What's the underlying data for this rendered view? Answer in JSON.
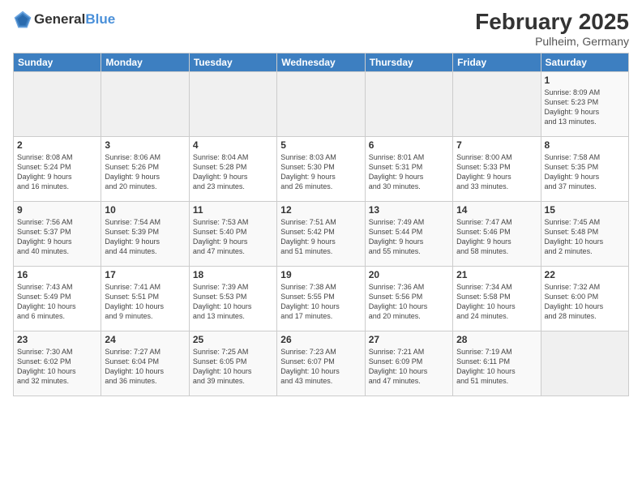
{
  "header": {
    "logo_general": "General",
    "logo_blue": "Blue",
    "title": "February 2025",
    "location": "Pulheim, Germany"
  },
  "days_of_week": [
    "Sunday",
    "Monday",
    "Tuesday",
    "Wednesday",
    "Thursday",
    "Friday",
    "Saturday"
  ],
  "weeks": [
    [
      {
        "day": "",
        "info": ""
      },
      {
        "day": "",
        "info": ""
      },
      {
        "day": "",
        "info": ""
      },
      {
        "day": "",
        "info": ""
      },
      {
        "day": "",
        "info": ""
      },
      {
        "day": "",
        "info": ""
      },
      {
        "day": "1",
        "info": "Sunrise: 8:09 AM\nSunset: 5:23 PM\nDaylight: 9 hours\nand 13 minutes."
      }
    ],
    [
      {
        "day": "2",
        "info": "Sunrise: 8:08 AM\nSunset: 5:24 PM\nDaylight: 9 hours\nand 16 minutes."
      },
      {
        "day": "3",
        "info": "Sunrise: 8:06 AM\nSunset: 5:26 PM\nDaylight: 9 hours\nand 20 minutes."
      },
      {
        "day": "4",
        "info": "Sunrise: 8:04 AM\nSunset: 5:28 PM\nDaylight: 9 hours\nand 23 minutes."
      },
      {
        "day": "5",
        "info": "Sunrise: 8:03 AM\nSunset: 5:30 PM\nDaylight: 9 hours\nand 26 minutes."
      },
      {
        "day": "6",
        "info": "Sunrise: 8:01 AM\nSunset: 5:31 PM\nDaylight: 9 hours\nand 30 minutes."
      },
      {
        "day": "7",
        "info": "Sunrise: 8:00 AM\nSunset: 5:33 PM\nDaylight: 9 hours\nand 33 minutes."
      },
      {
        "day": "8",
        "info": "Sunrise: 7:58 AM\nSunset: 5:35 PM\nDaylight: 9 hours\nand 37 minutes."
      }
    ],
    [
      {
        "day": "9",
        "info": "Sunrise: 7:56 AM\nSunset: 5:37 PM\nDaylight: 9 hours\nand 40 minutes."
      },
      {
        "day": "10",
        "info": "Sunrise: 7:54 AM\nSunset: 5:39 PM\nDaylight: 9 hours\nand 44 minutes."
      },
      {
        "day": "11",
        "info": "Sunrise: 7:53 AM\nSunset: 5:40 PM\nDaylight: 9 hours\nand 47 minutes."
      },
      {
        "day": "12",
        "info": "Sunrise: 7:51 AM\nSunset: 5:42 PM\nDaylight: 9 hours\nand 51 minutes."
      },
      {
        "day": "13",
        "info": "Sunrise: 7:49 AM\nSunset: 5:44 PM\nDaylight: 9 hours\nand 55 minutes."
      },
      {
        "day": "14",
        "info": "Sunrise: 7:47 AM\nSunset: 5:46 PM\nDaylight: 9 hours\nand 58 minutes."
      },
      {
        "day": "15",
        "info": "Sunrise: 7:45 AM\nSunset: 5:48 PM\nDaylight: 10 hours\nand 2 minutes."
      }
    ],
    [
      {
        "day": "16",
        "info": "Sunrise: 7:43 AM\nSunset: 5:49 PM\nDaylight: 10 hours\nand 6 minutes."
      },
      {
        "day": "17",
        "info": "Sunrise: 7:41 AM\nSunset: 5:51 PM\nDaylight: 10 hours\nand 9 minutes."
      },
      {
        "day": "18",
        "info": "Sunrise: 7:39 AM\nSunset: 5:53 PM\nDaylight: 10 hours\nand 13 minutes."
      },
      {
        "day": "19",
        "info": "Sunrise: 7:38 AM\nSunset: 5:55 PM\nDaylight: 10 hours\nand 17 minutes."
      },
      {
        "day": "20",
        "info": "Sunrise: 7:36 AM\nSunset: 5:56 PM\nDaylight: 10 hours\nand 20 minutes."
      },
      {
        "day": "21",
        "info": "Sunrise: 7:34 AM\nSunset: 5:58 PM\nDaylight: 10 hours\nand 24 minutes."
      },
      {
        "day": "22",
        "info": "Sunrise: 7:32 AM\nSunset: 6:00 PM\nDaylight: 10 hours\nand 28 minutes."
      }
    ],
    [
      {
        "day": "23",
        "info": "Sunrise: 7:30 AM\nSunset: 6:02 PM\nDaylight: 10 hours\nand 32 minutes."
      },
      {
        "day": "24",
        "info": "Sunrise: 7:27 AM\nSunset: 6:04 PM\nDaylight: 10 hours\nand 36 minutes."
      },
      {
        "day": "25",
        "info": "Sunrise: 7:25 AM\nSunset: 6:05 PM\nDaylight: 10 hours\nand 39 minutes."
      },
      {
        "day": "26",
        "info": "Sunrise: 7:23 AM\nSunset: 6:07 PM\nDaylight: 10 hours\nand 43 minutes."
      },
      {
        "day": "27",
        "info": "Sunrise: 7:21 AM\nSunset: 6:09 PM\nDaylight: 10 hours\nand 47 minutes."
      },
      {
        "day": "28",
        "info": "Sunrise: 7:19 AM\nSunset: 6:11 PM\nDaylight: 10 hours\nand 51 minutes."
      },
      {
        "day": "",
        "info": ""
      }
    ]
  ]
}
